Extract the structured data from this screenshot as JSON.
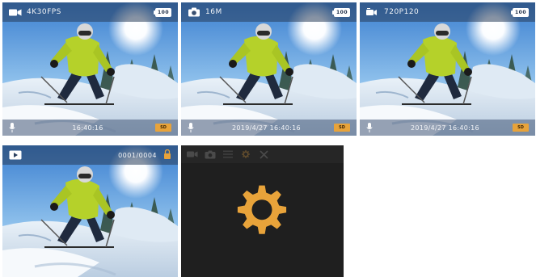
{
  "screens": [
    {
      "id": "video",
      "mode_label": "4K30FPS",
      "battery": "100",
      "datetime": "16:40:16",
      "sd_label": "SD"
    },
    {
      "id": "photo",
      "mode_label": "16M",
      "battery": "100",
      "datetime": "2019/4/27  16:40:16",
      "sd_label": "SD"
    },
    {
      "id": "burst",
      "mode_label": "720P120",
      "battery": "100",
      "datetime": "2019/4/27  16:40:16",
      "sd_label": "SD"
    },
    {
      "id": "playback",
      "file_name": "0001/0004"
    }
  ],
  "settings": {
    "tabs": [
      "video-tab-icon",
      "photo-tab-icon",
      "list-tab-icon",
      "gear-tab-icon",
      "tools-tab-icon"
    ],
    "main_icon": "gear-icon"
  },
  "colors": {
    "accent": "#e8a33a",
    "bar_overlay": "#283c5a",
    "settings_bg": "#1f1f1f",
    "icon_dim": "#4a4a4a"
  }
}
